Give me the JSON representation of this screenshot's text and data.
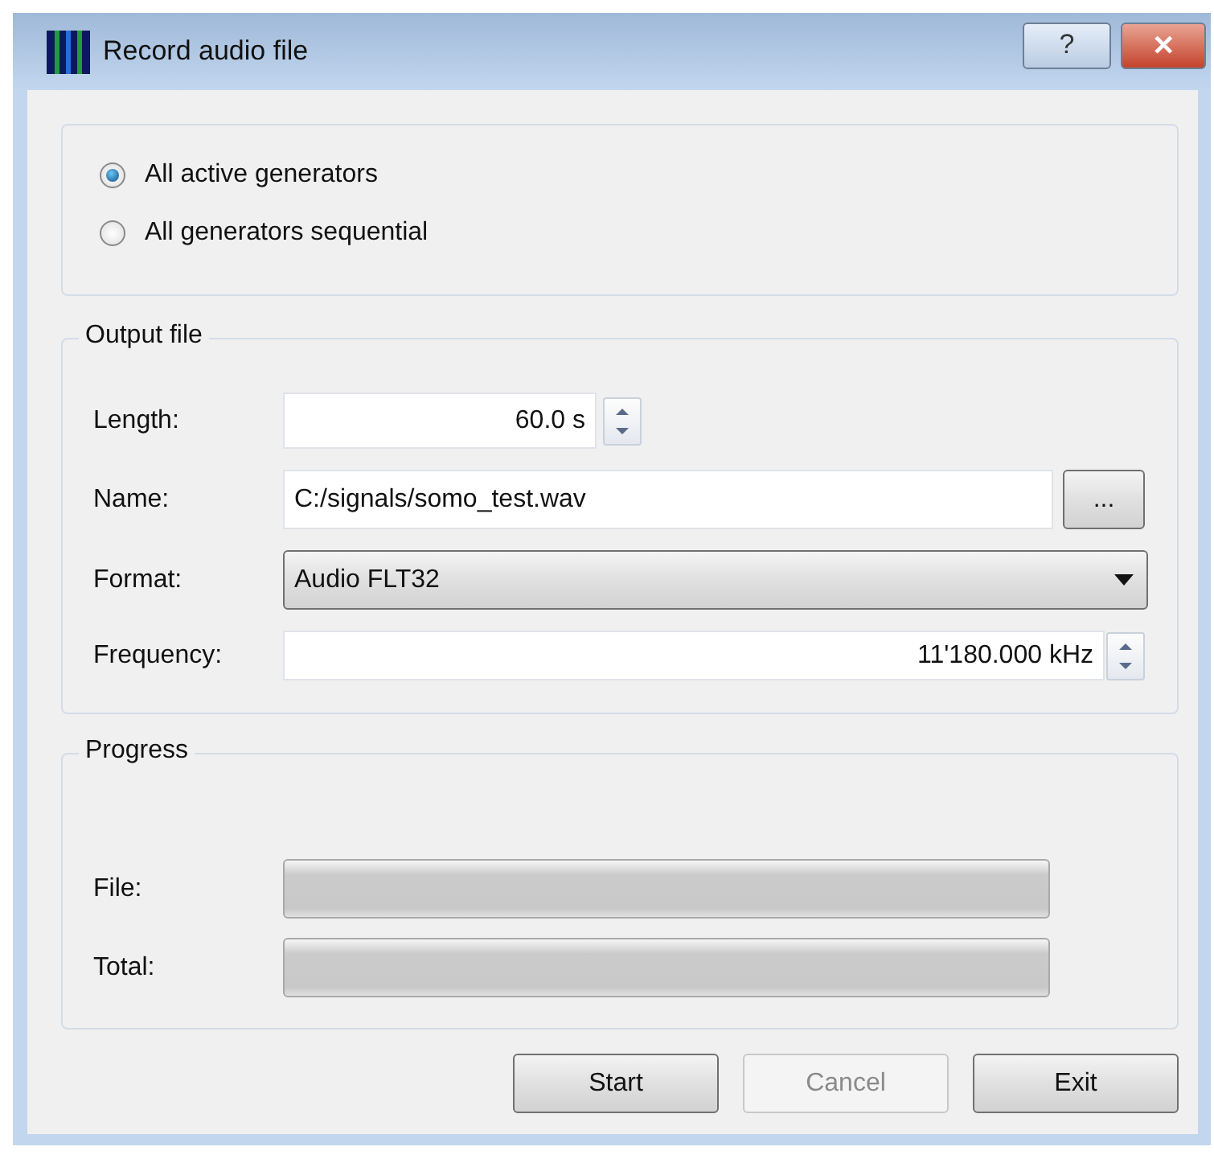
{
  "window": {
    "title": "Record audio file",
    "help_button": "?",
    "close_button": "✕"
  },
  "mode": [
    {
      "label": "All active generators",
      "selected": true
    },
    {
      "label": "All generators sequential",
      "selected": false
    }
  ],
  "output_file": {
    "title": "Output file",
    "length": {
      "label": "Length:",
      "value": "60.0 s"
    },
    "name": {
      "label": "Name:",
      "value": "C:/signals/somo_test.wav",
      "browse": "..."
    },
    "format": {
      "label": "Format:",
      "value": "Audio FLT32"
    },
    "frequency": {
      "label": "Frequency:",
      "value": "11'180.000 kHz"
    }
  },
  "progress": {
    "title": "Progress",
    "bars": [
      {
        "label": "File:",
        "level": 0
      },
      {
        "label": "Total:",
        "level": 0
      }
    ]
  },
  "buttons": [
    {
      "label": "Start",
      "disabled": false
    },
    {
      "label": "Cancel",
      "disabled": true
    },
    {
      "label": "Exit",
      "disabled": false
    }
  ]
}
